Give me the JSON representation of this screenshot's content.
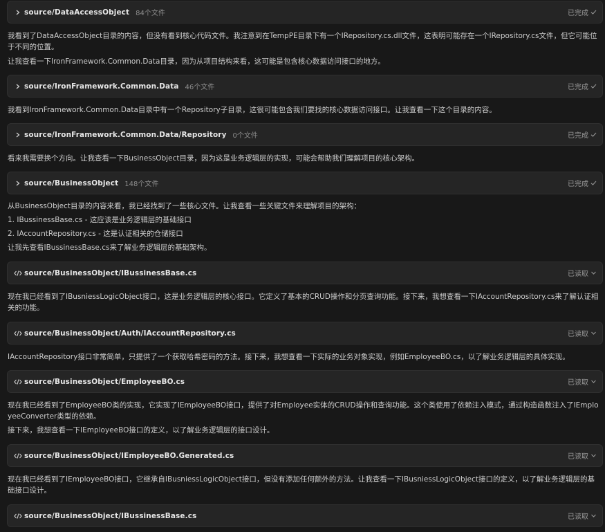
{
  "feed": [
    {
      "kind": "tool",
      "icon": "chevron-right-icon",
      "path": "source/DataAccessObject",
      "count": "84个文件",
      "status": "已完成",
      "status_icon": "check-icon"
    },
    {
      "kind": "text",
      "lines": [
        "我看到了DataAccessObject目录的内容，但没有看到核心代码文件。我注意到在TempPE目录下有一个IRepository.cs.dll文件，这表明可能存在一个IRepository.cs文件，但它可能位于不同的位置。"
      ]
    },
    {
      "kind": "text",
      "lines": [
        "让我查看一下IronFramework.Common.Data目录，因为从项目结构来看，这可能是包含核心数据访问接口的地方。"
      ]
    },
    {
      "kind": "tool",
      "icon": "chevron-right-icon",
      "path": "source/IronFramework.Common.Data",
      "count": "46个文件",
      "status": "已完成",
      "status_icon": "check-icon"
    },
    {
      "kind": "text",
      "lines": [
        "我看到IronFramework.Common.Data目录中有一个Repository子目录，这很可能包含我们要找的核心数据访问接口。让我查看一下这个目录的内容。"
      ]
    },
    {
      "kind": "tool",
      "icon": "chevron-right-icon",
      "path": "source/IronFramework.Common.Data/Repository",
      "count": "0个文件",
      "status": "已完成",
      "status_icon": "check-icon"
    },
    {
      "kind": "text",
      "lines": [
        "看来我需要换个方向。让我查看一下BusinessObject目录，因为这是业务逻辑层的实现，可能会帮助我们理解项目的核心架构。"
      ]
    },
    {
      "kind": "tool",
      "icon": "chevron-right-icon",
      "path": "source/BusinessObject",
      "count": "148个文件",
      "status": "已完成",
      "status_icon": "check-icon"
    },
    {
      "kind": "text",
      "lines": [
        "从BusinessObject目录的内容来看，我已经找到了一些核心文件。让我查看一些关键文件来理解项目的架构：",
        "1. IBussinessBase.cs - 这应该是业务逻辑层的基础接口",
        "2. IAccountRepository.cs - 这是认证相关的仓储接口",
        "让我先查看IBussinessBase.cs来了解业务逻辑层的基础架构。"
      ]
    },
    {
      "kind": "tool",
      "icon": "code-icon",
      "path": "source/BusinessObject/IBussinessBase.cs",
      "count": "",
      "status": "已读取",
      "status_icon": "chevron-down-icon"
    },
    {
      "kind": "text",
      "lines": [
        "现在我已经看到了IBusniessLogicObject接口，这是业务逻辑层的核心接口。它定义了基本的CRUD操作和分页查询功能。接下来，我想查看一下IAccountRepository.cs来了解认证相关的功能。"
      ]
    },
    {
      "kind": "tool",
      "icon": "code-icon",
      "path": "source/BusinessObject/Auth/IAccountRepository.cs",
      "count": "",
      "status": "已读取",
      "status_icon": "chevron-down-icon"
    },
    {
      "kind": "text",
      "lines": [
        "IAccountRepository接口非常简单，只提供了一个获取哈希密码的方法。接下来，我想查看一下实际的业务对象实现，例如EmployeeBO.cs，以了解业务逻辑层的具体实现。"
      ]
    },
    {
      "kind": "tool",
      "icon": "code-icon",
      "path": "source/BusinessObject/EmployeeBO.cs",
      "count": "",
      "status": "已读取",
      "status_icon": "chevron-down-icon"
    },
    {
      "kind": "text",
      "lines": [
        "现在我已经看到了EmployeeBO类的实现，它实现了IEmployeeBO接口，提供了对Employee实体的CRUD操作和查询功能。这个类使用了依赖注入模式，通过构造函数注入了IEmployeeConverter类型的依赖。"
      ]
    },
    {
      "kind": "text",
      "lines": [
        "接下来，我想查看一下IEmployeeBO接口的定义，以了解业务逻辑层的接口设计。"
      ]
    },
    {
      "kind": "tool",
      "icon": "code-icon",
      "path": "source/BusinessObject/IEmployeeBO.Generated.cs",
      "count": "",
      "status": "已读取",
      "status_icon": "chevron-down-icon"
    },
    {
      "kind": "text",
      "lines": [
        "现在我已经看到了IEmployeeBO接口，它继承自IBusniessLogicObject接口，但没有添加任何额外的方法。让我查看一下IBusniessLogicObject接口的定义，以了解业务逻辑层的基础接口设计。"
      ]
    },
    {
      "kind": "tool",
      "icon": "code-icon",
      "path": "source/BusinessObject/IBussinessBase.cs",
      "count": "",
      "status": "已读取",
      "status_icon": "chevron-down-icon"
    }
  ]
}
